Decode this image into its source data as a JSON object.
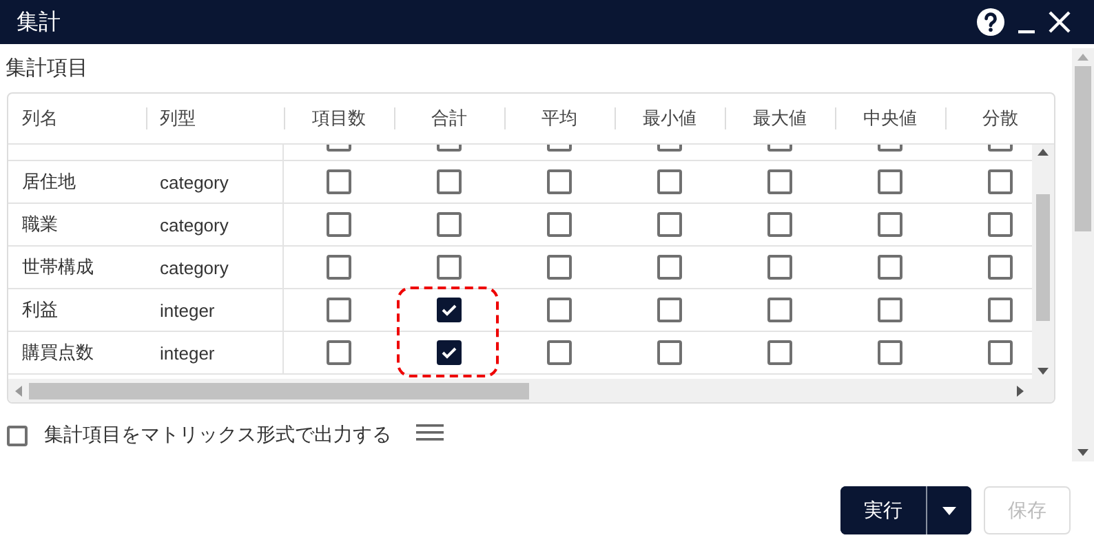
{
  "window": {
    "title": "集計"
  },
  "section_title": "集計項目",
  "table": {
    "columns": [
      "列名",
      "列型",
      "項目数",
      "合計",
      "平均",
      "最小値",
      "最大値",
      "中央値",
      "分散"
    ],
    "partial_row": {
      "checks": [
        false,
        false,
        false,
        false,
        false,
        false,
        false
      ]
    },
    "rows": [
      {
        "name": "居住地",
        "type": "category",
        "checks": [
          false,
          false,
          false,
          false,
          false,
          false,
          false
        ]
      },
      {
        "name": "職業",
        "type": "category",
        "checks": [
          false,
          false,
          false,
          false,
          false,
          false,
          false
        ]
      },
      {
        "name": "世帯構成",
        "type": "category",
        "checks": [
          false,
          false,
          false,
          false,
          false,
          false,
          false
        ]
      },
      {
        "name": "利益",
        "type": "integer",
        "checks": [
          false,
          true,
          false,
          false,
          false,
          false,
          false
        ],
        "highlighted": true
      },
      {
        "name": "購買点数",
        "type": "integer",
        "checks": [
          false,
          true,
          false,
          false,
          false,
          false,
          false
        ],
        "highlighted": true
      }
    ]
  },
  "matrix_option": {
    "label": "集計項目をマトリックス形式で出力する",
    "checked": false
  },
  "buttons": {
    "run": "実行",
    "save": "保存",
    "save_disabled": true
  }
}
